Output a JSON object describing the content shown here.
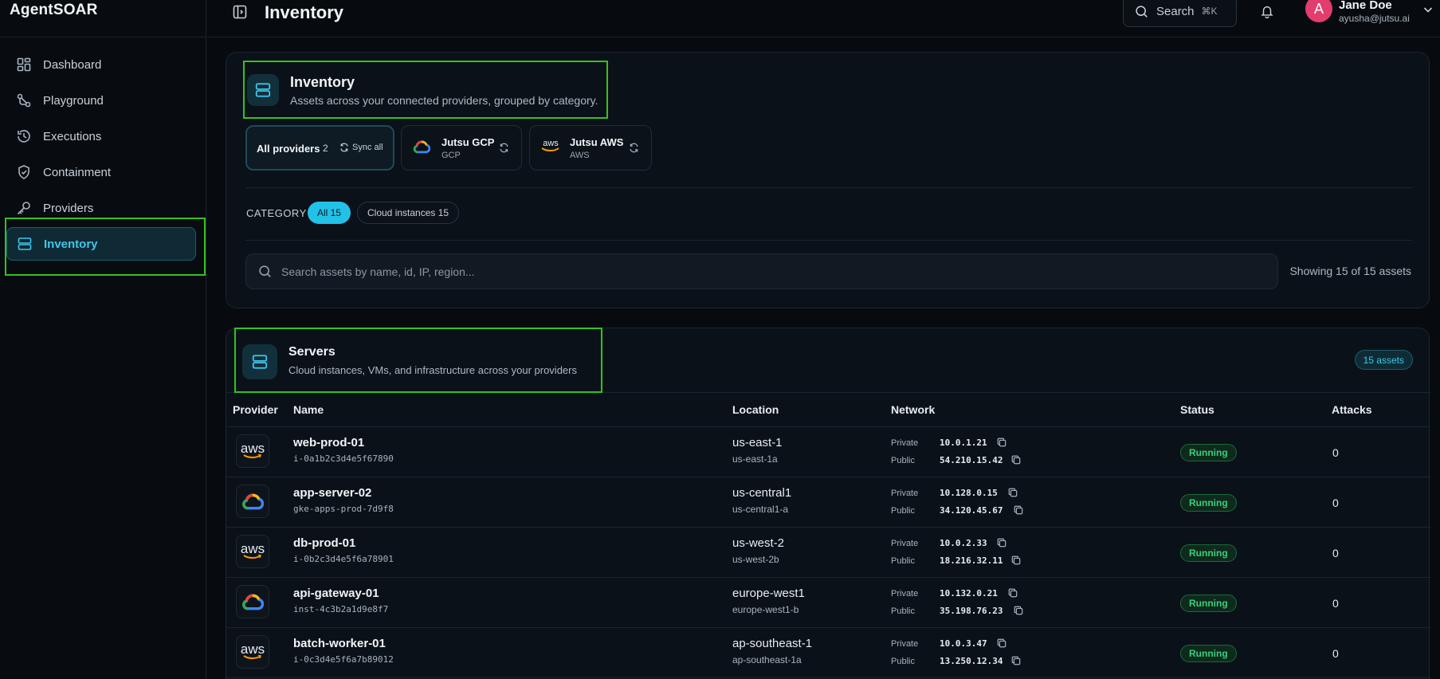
{
  "app": {
    "brand": "AgentSOAR"
  },
  "sidebar": {
    "items": [
      {
        "label": "Dashboard",
        "icon": "dashboard-icon"
      },
      {
        "label": "Playground",
        "icon": "playground-icon"
      },
      {
        "label": "Executions",
        "icon": "history-icon"
      },
      {
        "label": "Containment",
        "icon": "shield-icon"
      },
      {
        "label": "Providers",
        "icon": "key-icon"
      },
      {
        "label": "Inventory",
        "icon": "server-icon",
        "active": true
      }
    ]
  },
  "header": {
    "title": "Inventory",
    "search_label": "Search",
    "search_shortcut": "⌘K",
    "user": {
      "initial": "A",
      "name": "Jane Doe",
      "email": "ayusha@jutsu.ai"
    }
  },
  "inventory": {
    "title": "Inventory",
    "subtitle": "Assets across your connected providers, grouped by category.",
    "providers": {
      "all": {
        "label": "All providers",
        "count": "2",
        "sync_label": "Sync all"
      },
      "gcp": {
        "name": "Jutsu GCP",
        "type": "GCP"
      },
      "aws": {
        "name": "Jutsu AWS",
        "type": "AWS"
      }
    },
    "category": {
      "label": "CATEGORY",
      "chips": [
        {
          "label": "All 15",
          "active": true
        },
        {
          "label": "Cloud instances 15",
          "active": false
        }
      ]
    },
    "search_placeholder": "Search assets by name, id, IP, region...",
    "showing": "Showing 15 of 15 assets"
  },
  "servers": {
    "title": "Servers",
    "subtitle": "Cloud instances, VMs, and infrastructure across your providers",
    "badge": "15 assets",
    "columns": [
      "Provider",
      "Name",
      "Location",
      "Network",
      "Status",
      "Attacks"
    ],
    "private_label": "Private",
    "public_label": "Public",
    "rows": [
      {
        "provider": "aws",
        "name": "web-prod-01",
        "id": "i-0a1b2c3d4e5f67890",
        "location": "us-east-1",
        "zone": "us-east-1a",
        "private_ip": "10.0.1.21",
        "public_ip": "54.210.15.42",
        "status": "Running",
        "attacks": "0"
      },
      {
        "provider": "gcp",
        "name": "app-server-02",
        "id": "gke-apps-prod-7d9f8",
        "location": "us-central1",
        "zone": "us-central1-a",
        "private_ip": "10.128.0.15",
        "public_ip": "34.120.45.67",
        "status": "Running",
        "attacks": "0"
      },
      {
        "provider": "aws",
        "name": "db-prod-01",
        "id": "i-0b2c3d4e5f6a78901",
        "location": "us-west-2",
        "zone": "us-west-2b",
        "private_ip": "10.0.2.33",
        "public_ip": "18.216.32.11",
        "status": "Running",
        "attacks": "0"
      },
      {
        "provider": "gcp",
        "name": "api-gateway-01",
        "id": "inst-4c3b2a1d9e8f7",
        "location": "europe-west1",
        "zone": "europe-west1-b",
        "private_ip": "10.132.0.21",
        "public_ip": "35.198.76.23",
        "status": "Running",
        "attacks": "0"
      },
      {
        "provider": "aws",
        "name": "batch-worker-01",
        "id": "i-0c3d4e5f6a7b89012",
        "location": "ap-southeast-1",
        "zone": "ap-southeast-1a",
        "private_ip": "10.0.3.47",
        "public_ip": "13.250.12.34",
        "status": "Running",
        "attacks": "0"
      }
    ]
  },
  "colors": {
    "accent": "#22c2e8",
    "highlight": "#34c21e",
    "running": "#38d07a",
    "background": "#070b10"
  }
}
